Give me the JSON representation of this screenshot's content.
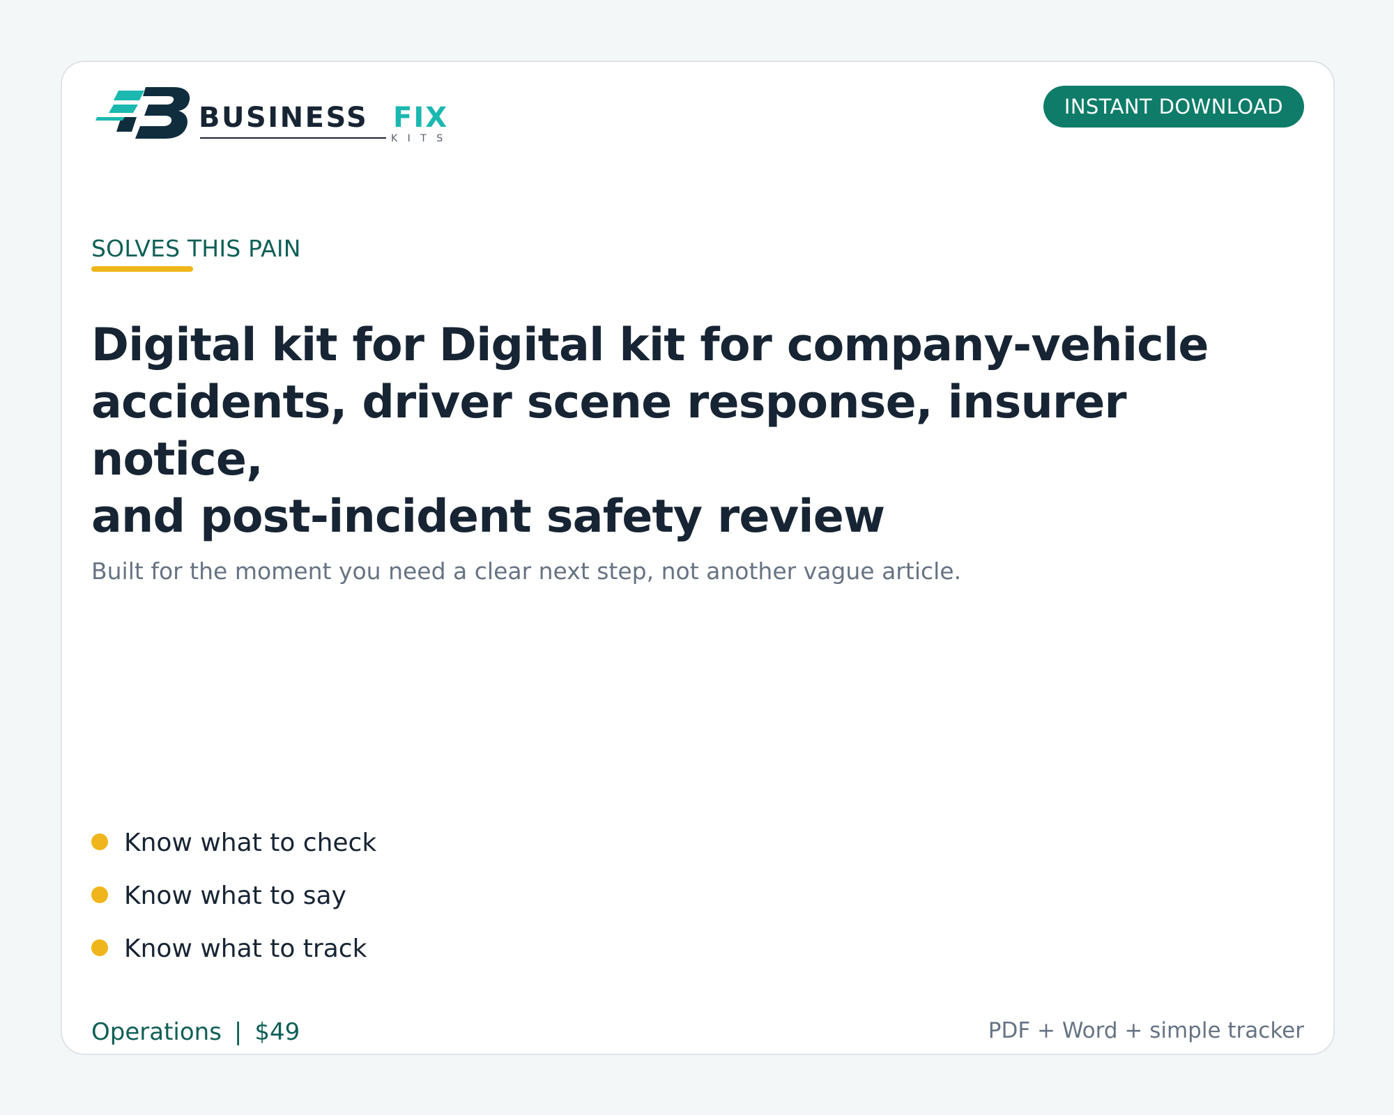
{
  "brand": {
    "name_primary": "BUSINESS",
    "name_accent": "FIX",
    "tagline": "K I T S",
    "logo_icon": "business-fix-monogram-icon"
  },
  "header": {
    "badge_label": "INSTANT DOWNLOAD"
  },
  "pain": {
    "label": "SOLVES THIS PAIN"
  },
  "headline": {
    "line_1": "Digital kit for Digital kit for company-vehicle",
    "line_2": "accidents, driver scene response, insurer notice,",
    "line_3": "and post-incident safety review"
  },
  "subtitle": "Built for the moment you need a clear next step, not another vague article.",
  "benefits": [
    {
      "label": "Know what to check",
      "icon": "bullet-dot-icon"
    },
    {
      "label": "Know what to say",
      "icon": "bullet-dot-icon"
    },
    {
      "label": "Know what to track",
      "icon": "bullet-dot-icon"
    }
  ],
  "footer": {
    "category": "Operations",
    "separator": "|",
    "price": "$49",
    "formats": "PDF + Word + simple tracker"
  },
  "colors": {
    "background": "#f3f7f8",
    "card": "#ffffff",
    "primary_green": "#0e7c69",
    "dark_green": "#0f5f56",
    "accent_teal": "#1bb8b0",
    "accent_yellow": "#efb51a",
    "heading_text": "#172433",
    "muted_text": "#667383"
  }
}
